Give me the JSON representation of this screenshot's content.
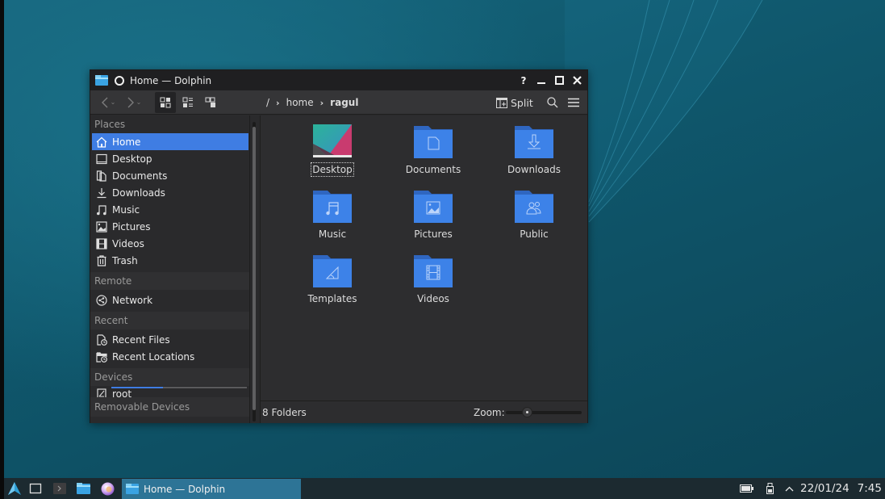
{
  "window": {
    "title": "Home — Dolphin",
    "buttons": {
      "help": "?",
      "minimize": "_",
      "maximize": "□",
      "close": "✕"
    }
  },
  "toolbar": {
    "back_icon": "chevron-left",
    "forward_icon": "chevron-right",
    "view_modes": [
      "icons",
      "compact",
      "details"
    ],
    "active_view": "icons",
    "breadcrumb": [
      {
        "label": "/"
      },
      {
        "label": "home"
      },
      {
        "label": "ragul",
        "current": true
      }
    ],
    "split_label": "Split"
  },
  "sidebar": {
    "sections": [
      {
        "title": "Places",
        "items": [
          {
            "label": "Home",
            "icon": "home-icon",
            "selected": true
          },
          {
            "label": "Desktop",
            "icon": "desktop-icon"
          },
          {
            "label": "Documents",
            "icon": "documents-icon"
          },
          {
            "label": "Downloads",
            "icon": "downloads-icon"
          },
          {
            "label": "Music",
            "icon": "music-icon"
          },
          {
            "label": "Pictures",
            "icon": "pictures-icon"
          },
          {
            "label": "Videos",
            "icon": "videos-icon"
          },
          {
            "label": "Trash",
            "icon": "trash-icon"
          }
        ]
      },
      {
        "title": "Remote",
        "items": [
          {
            "label": "Network",
            "icon": "network-icon"
          }
        ]
      },
      {
        "title": "Recent",
        "items": [
          {
            "label": "Recent Files",
            "icon": "recent-files-icon"
          },
          {
            "label": "Recent Locations",
            "icon": "recent-locations-icon"
          }
        ]
      },
      {
        "title": "Devices",
        "items": [
          {
            "label": "root",
            "icon": "drive-icon",
            "usage_fraction": 0.38
          }
        ]
      },
      {
        "title": "Removable Devices",
        "items": []
      }
    ]
  },
  "content": {
    "items": [
      {
        "label": "Desktop",
        "type": "desktop",
        "focused": true
      },
      {
        "label": "Documents",
        "type": "folder",
        "emblem": "document"
      },
      {
        "label": "Downloads",
        "type": "folder",
        "emblem": "download"
      },
      {
        "label": "Music",
        "type": "folder",
        "emblem": "music"
      },
      {
        "label": "Pictures",
        "type": "folder",
        "emblem": "picture"
      },
      {
        "label": "Public",
        "type": "folder",
        "emblem": "users"
      },
      {
        "label": "Templates",
        "type": "folder",
        "emblem": "template"
      },
      {
        "label": "Videos",
        "type": "folder",
        "emblem": "video"
      }
    ],
    "folder_color": "#3d82e8",
    "folder_tab_color": "#2f66c0"
  },
  "statusbar": {
    "summary": "8 Folders",
    "zoom_label": "Zoom:",
    "zoom_fraction": 0.28
  },
  "taskbar": {
    "launchers": [
      "application-launcher-icon",
      "show-desktop-icon",
      "terminal-icon",
      "file-manager-icon",
      "web-browser-icon"
    ],
    "task_label": "Home — Dolphin",
    "date": "22/01/24",
    "time": "7:45"
  },
  "colors": {
    "accent": "#3f7de3",
    "window_bg": "#2a2a2c",
    "titlebar_bg": "#1f1f21",
    "taskbar_bg": "#1c2a30",
    "task_active": "#2d7496"
  }
}
